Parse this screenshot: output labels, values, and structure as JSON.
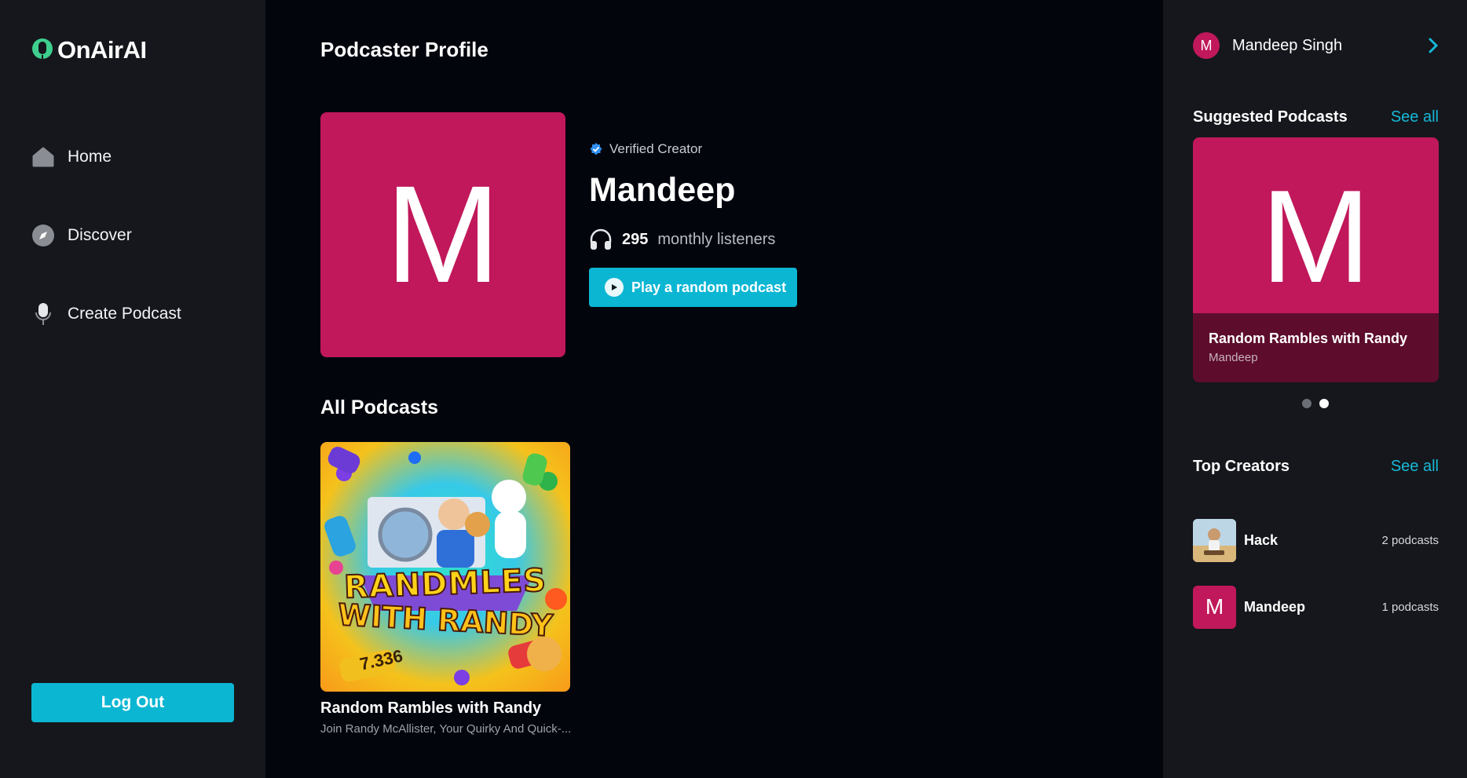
{
  "brand": {
    "name": "OnAirAI"
  },
  "nav": {
    "items": [
      {
        "label": "Home",
        "icon": "home-icon"
      },
      {
        "label": "Discover",
        "icon": "compass-icon"
      },
      {
        "label": "Create Podcast",
        "icon": "microphone-icon"
      }
    ],
    "logout_label": "Log Out"
  },
  "main": {
    "page_title": "Podcaster Profile",
    "profile": {
      "initial": "M",
      "verified_label": "Verified Creator",
      "name": "Mandeep",
      "listeners_count": "295",
      "listeners_label": "monthly listeners",
      "play_random_label": "Play a random podcast"
    },
    "all_podcasts_title": "All Podcasts",
    "podcasts": [
      {
        "title": "Random Rambles with Randy",
        "description": "Join Randy McAllister, Your Quirky And Quick-...",
        "art_text_line1": "RANDMLES",
        "art_text_line2": "WITH RANDY",
        "art_tag": "7.336"
      }
    ]
  },
  "right_panel": {
    "user": {
      "initial": "M",
      "name": "Mandeep Singh"
    },
    "suggested": {
      "title": "Suggested Podcasts",
      "see_all": "See all",
      "card": {
        "initial": "M",
        "title": "Random Rambles with Randy",
        "author": "Mandeep"
      },
      "active_dot": 1
    },
    "top_creators": {
      "title": "Top Creators",
      "see_all": "See all",
      "items": [
        {
          "name": "Hack",
          "count": "2 podcasts"
        },
        {
          "initial": "M",
          "name": "Mandeep",
          "count": "1 podcasts"
        }
      ]
    }
  },
  "colors": {
    "accent": "#0bb6d3",
    "brand_magenta": "#c0185b",
    "sidebar_bg": "#15171c",
    "main_bg": "#03050d"
  }
}
